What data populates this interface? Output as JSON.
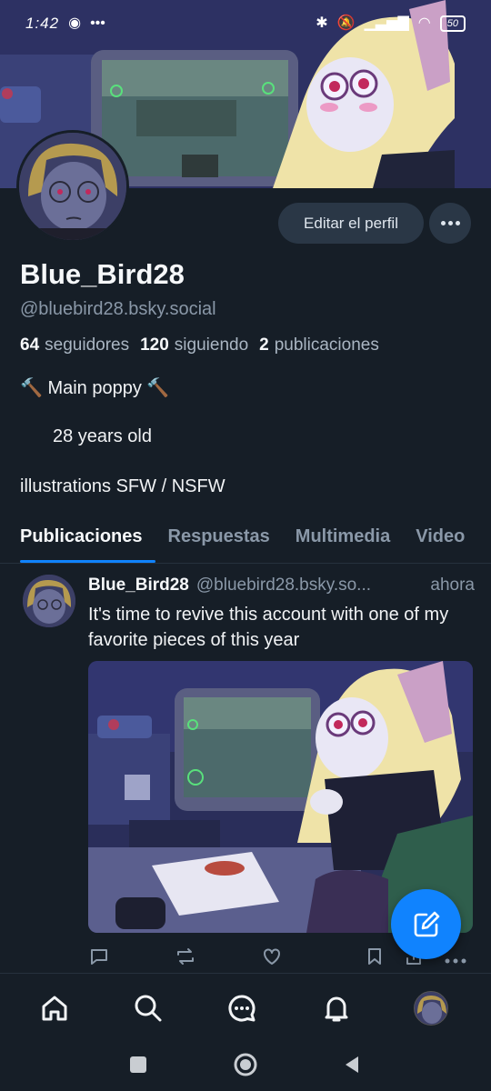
{
  "status": {
    "time": "1:42",
    "battery": "50"
  },
  "profile": {
    "edit_label": "Editar el perfil",
    "display_name": "Blue_Bird28",
    "handle": "@bluebird28.bsky.social",
    "followers_count": "64",
    "followers_label": "seguidores",
    "following_count": "120",
    "following_label": "siguiendo",
    "posts_count": "2",
    "posts_label": "publicaciones",
    "bio_line1": "🔨 Main poppy 🔨",
    "bio_line2": "28 years old",
    "bio_line3": "illustrations SFW / NSFW"
  },
  "tabs": [
    {
      "label": "Publicaciones",
      "active": true
    },
    {
      "label": "Respuestas",
      "active": false
    },
    {
      "label": "Multimedia",
      "active": false
    },
    {
      "label": "Video",
      "active": false
    }
  ],
  "post": {
    "author": "Blue_Bird28",
    "handle": "@bluebird28.bsky.so...",
    "time": "ahora",
    "text": "It's time to revive this account with one of my favorite pieces of this year"
  },
  "accent": "#1083fe",
  "bottom_nav": [
    "home-icon",
    "search-icon",
    "chat-icon",
    "bell-icon",
    "profile-avatar"
  ]
}
